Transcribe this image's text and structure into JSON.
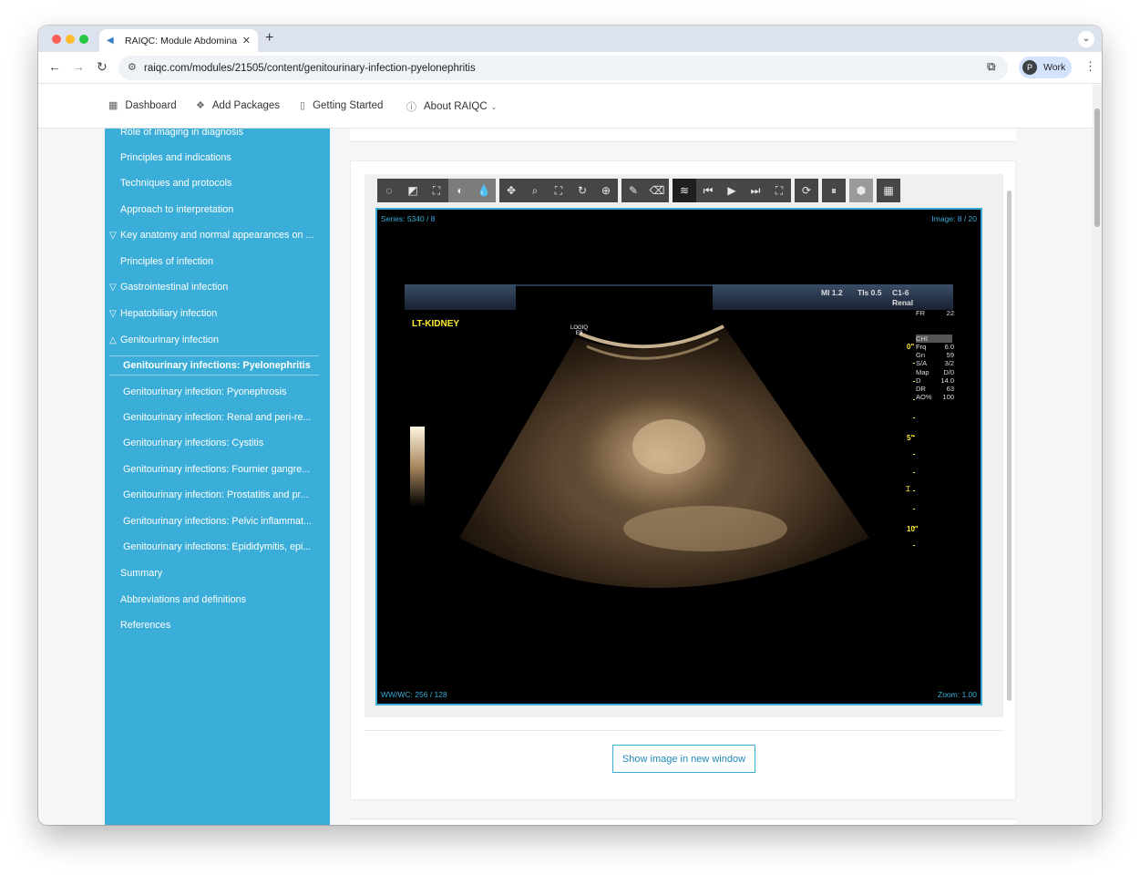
{
  "browser": {
    "tab_title": "RAIQC: Module Abdominal an",
    "url": "raiqc.com/modules/21505/content/genitourinary-infection-pyelonephritis",
    "profile_initial": "P",
    "profile_label": "Work"
  },
  "topnav": {
    "dashboard": "Dashboard",
    "add_packages": "Add Packages",
    "getting_started": "Getting Started",
    "about": "About RAIQC"
  },
  "sidebar": {
    "items": [
      {
        "label": "Role of imaging in diagnosis",
        "marker": ""
      },
      {
        "label": "Principles and indications",
        "marker": ""
      },
      {
        "label": "Techniques and protocols",
        "marker": ""
      },
      {
        "label": "Approach to interpretation",
        "marker": ""
      },
      {
        "label": "Key anatomy and normal appearances on ...",
        "marker": "▽"
      },
      {
        "label": "Principles of infection",
        "marker": ""
      },
      {
        "label": "Gastrointestinal infection",
        "marker": "▽"
      },
      {
        "label": "Hepatobiliary infection",
        "marker": "▽"
      },
      {
        "label": "Genitourinary infection",
        "marker": "△"
      },
      {
        "label": "Genitourinary infections: Pyelonephritis",
        "marker": ""
      },
      {
        "label": "Genitourinary infection: Pyonephrosis",
        "marker": ""
      },
      {
        "label": "Genitourinary infection: Renal and peri-re...",
        "marker": ""
      },
      {
        "label": "Genitourinary infections: Cystitis",
        "marker": ""
      },
      {
        "label": "Genitourinary infections: Fournier gangre...",
        "marker": ""
      },
      {
        "label": "Genitourinary infection: Prostatitis and pr...",
        "marker": ""
      },
      {
        "label": "Genitourinary infections: Pelvic inflammat...",
        "marker": ""
      },
      {
        "label": "Genitourinary infections: Epididymitis, epi...",
        "marker": ""
      },
      {
        "label": "Summary",
        "marker": ""
      },
      {
        "label": "Abbreviations and definitions",
        "marker": ""
      },
      {
        "label": "References",
        "marker": ""
      }
    ],
    "active_index": 9
  },
  "viewer": {
    "series": "Series: 5340 / 8",
    "image": "Image: 8 / 20",
    "wwwc": "WW/WC: 256 / 128",
    "zoom": "Zoom: 1.00",
    "side_label": "LT-KIDNEY",
    "logo_line1": "LOGIQ",
    "logo_line2": "E9",
    "mi": "MI 1.2",
    "tis": "TIs 0.5",
    "probe": "C1-6",
    "preset": "Renal",
    "fr_label": "FR",
    "fr_value": "22",
    "chi": "CHI",
    "params": [
      {
        "k": "Frq",
        "v": "6.0"
      },
      {
        "k": "Gn",
        "v": "59"
      },
      {
        "k": "S/A",
        "v": "3/2"
      },
      {
        "k": "Map",
        "v": "D/0"
      },
      {
        "k": "D",
        "v": "14.0"
      },
      {
        "k": "DR",
        "v": "63"
      },
      {
        "k": "AO%",
        "v": "100"
      }
    ],
    "depth_0": "0\"",
    "depth_5": "5\"",
    "depth_10": "10\""
  },
  "actions": {
    "show_image": "Show image in new window"
  },
  "colors": {
    "sidebar": "#3aaed8",
    "accent": "#1f88b8",
    "overlay_yellow": "#ffee33"
  }
}
